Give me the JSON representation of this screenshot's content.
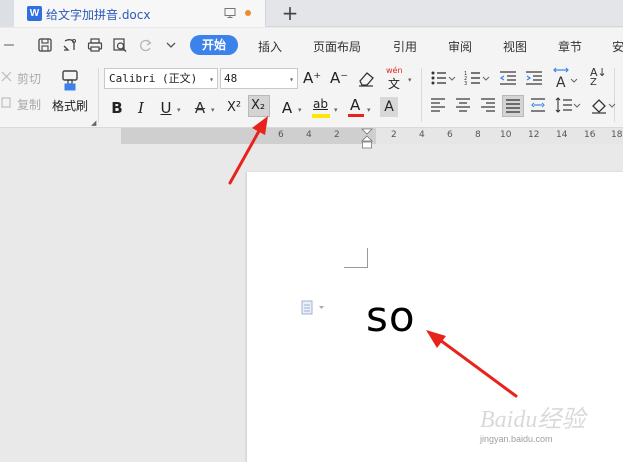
{
  "tabbar": {
    "doc_icon": "W",
    "doc_title": "给文字加拼音.docx",
    "new_tab": "+"
  },
  "menubar": {
    "items": [
      "开始",
      "插入",
      "页面布局",
      "引用",
      "审阅",
      "视图",
      "章节",
      "安"
    ],
    "active": "开始"
  },
  "ribbon": {
    "cut_label": "剪切",
    "copy_label": "复制",
    "format_painter_label": "格式刷",
    "font_name": "Calibri (正文)",
    "font_size": "48",
    "bold": "B",
    "italic": "I",
    "underline": "U",
    "strikethrough": "A",
    "superscript": "X²",
    "subscript": "X₂",
    "text_effect": "A",
    "highlight": "ab",
    "font_color": "A",
    "char_shading": "A",
    "grow_font": "A⁺",
    "shrink_font": "A⁻",
    "phonetic_guide": "wén",
    "sort": "A↓",
    "sort_bottom": "Z"
  },
  "ruler": {
    "ticks": [
      "6",
      "4",
      "2",
      "2",
      "4",
      "6",
      "8",
      "10",
      "12",
      "14",
      "16",
      "18"
    ]
  },
  "document": {
    "text": "so"
  },
  "watermark": {
    "brand": "Baidu经验",
    "url": "jingyan.baidu.com"
  },
  "colors": {
    "accent": "#3b82ea",
    "annotation": "#e8231b",
    "highlight_bar": "#ffe600",
    "font_color_bar": "#e8231b"
  }
}
